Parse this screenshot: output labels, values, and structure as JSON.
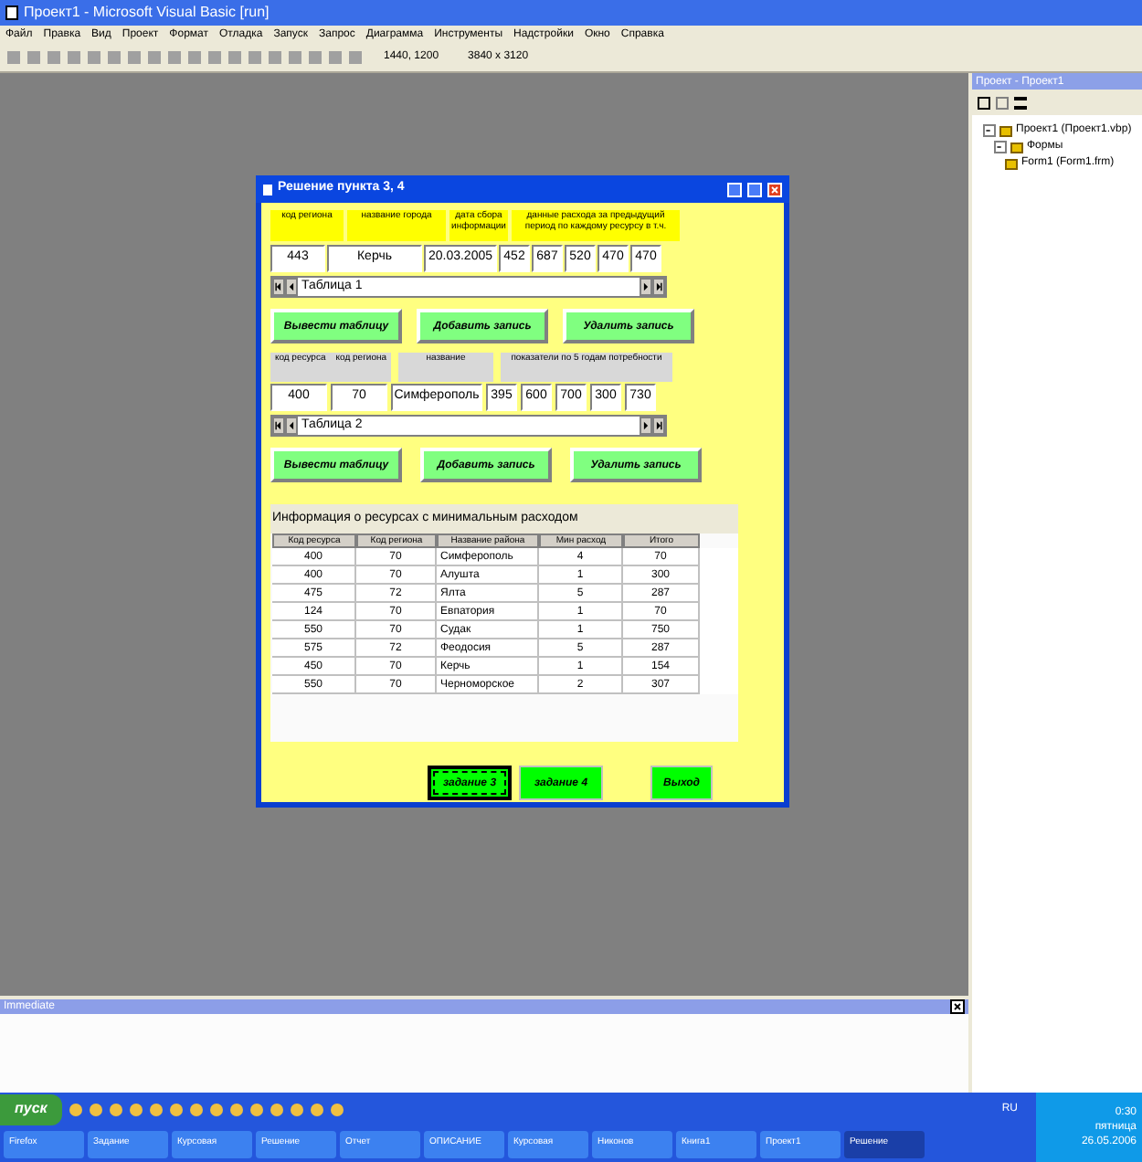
{
  "window": {
    "title": "Проект1 - Microsoft Visual Basic [run]"
  },
  "menu": [
    "Файл",
    "Правка",
    "Вид",
    "Проект",
    "Формат",
    "Отладка",
    "Запуск",
    "Запрос",
    "Диаграмма",
    "Инструменты",
    "Надстройки",
    "Окно",
    "Справка"
  ],
  "toolbar": {
    "position": "1440, 1200",
    "size": "3840 x 3120"
  },
  "form": {
    "title": "Решение пункта 3, 4",
    "section_1": {
      "labels": [
        "код региона",
        "название города",
        "дата сбора информации",
        "данные расхода за предыдущий период по каждому ресурсу в т.ч."
      ],
      "values": [
        "443",
        "Керчь",
        "20.03.2005",
        "452",
        "687",
        "520",
        "470",
        "470"
      ],
      "data_caption": "Таблица 1",
      "buttons": [
        "Вывести таблицу",
        "Добавить запись",
        "Удалить запись"
      ]
    },
    "section_2": {
      "labels": [
        "код ресурса    код региона",
        "название",
        "показатели по 5 годам потребности"
      ],
      "values": [
        "400",
        "70",
        "Симферополь",
        "395",
        "600",
        "700",
        "300",
        "730"
      ],
      "data_caption": "Таблица 2",
      "buttons": [
        "Вывести таблицу",
        "Добавить запись",
        "Удалить запись"
      ]
    },
    "grid": {
      "title": "Информация о ресурсах с минимальным расходом",
      "columns": [
        "Код ресурса",
        "Код региона",
        "Название района",
        "Мин расход",
        "Итого"
      ],
      "rows": [
        [
          "400",
          "70",
          "Симферополь",
          "4",
          "70"
        ],
        [
          "400",
          "70",
          "Алушта",
          "1",
          "300"
        ],
        [
          "475",
          "72",
          "Ялта",
          "5",
          "287"
        ],
        [
          "124",
          "70",
          "Евпатория",
          "1",
          "70"
        ],
        [
          "550",
          "70",
          "Судак",
          "1",
          "750"
        ],
        [
          "575",
          "72",
          "Феодосия",
          "5",
          "287"
        ],
        [
          "450",
          "70",
          "Керчь",
          "1",
          "154"
        ],
        [
          "550",
          "70",
          "Черноморское",
          "2",
          "307"
        ]
      ]
    },
    "bottom_buttons": [
      {
        "label": "задание 3",
        "focused": true
      },
      {
        "label": "задание 4",
        "focused": false
      },
      {
        "label": "Выход",
        "focused": false
      }
    ]
  },
  "project_panel": {
    "title": "Проект - Проект1",
    "tree": [
      {
        "label": "Проект1 (Проект1.vbp)",
        "expanded": true,
        "children": [
          {
            "label": "Формы",
            "expanded": true,
            "children": [
              {
                "label": "Form1 (Form1.frm)"
              }
            ]
          }
        ]
      }
    ]
  },
  "immediate": {
    "title": "Immediate"
  },
  "taskbar": {
    "start": "пуск",
    "language": "RU",
    "time": "0:30",
    "day": "пятница",
    "date": "26.05.2006",
    "tasks": [
      {
        "label": "Firefox",
        "selected": false
      },
      {
        "label": "Задание",
        "selected": false
      },
      {
        "label": "Курсовая",
        "selected": false
      },
      {
        "label": "Решение",
        "selected": false
      },
      {
        "label": "Отчет",
        "selected": false
      },
      {
        "label": "ОПИСАНИЕ",
        "selected": false
      },
      {
        "label": "Курсовая",
        "selected": false
      },
      {
        "label": "Никонов",
        "selected": false
      },
      {
        "label": "Книга1",
        "selected": false
      },
      {
        "label": "Проект1",
        "selected": false
      },
      {
        "label": "Решение",
        "selected": true
      }
    ]
  }
}
